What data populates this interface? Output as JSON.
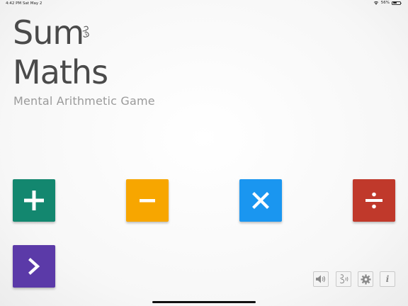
{
  "status_bar": {
    "time": "4:42 PM",
    "date": "Sat May 2",
    "battery": "56%",
    "battery_level": 0.56,
    "icons": [
      "wifi-icon",
      "battery-icon"
    ]
  },
  "app": {
    "title_line1": "Sum",
    "title_line2": "Maths",
    "subtitle": "Mental Arithmetic Game",
    "logo_icon": "doodle-logo-icon"
  },
  "operations": [
    {
      "name": "addition-button",
      "icon": "plus-icon",
      "color": "#13876f"
    },
    {
      "name": "subtraction-button",
      "icon": "minus-icon",
      "color": "#f7a600"
    },
    {
      "name": "multiplication-button",
      "icon": "times-icon",
      "color": "#1a96f0"
    },
    {
      "name": "division-button",
      "icon": "divide-icon",
      "color": "#c0392b"
    }
  ],
  "next_button": {
    "icon": "chevron-right-icon",
    "color": "#5b3aa8"
  },
  "utility_buttons": [
    {
      "name": "sound-button",
      "icon": "speaker-icon"
    },
    {
      "name": "voice-button",
      "icon": "voice-icon"
    },
    {
      "name": "settings-button",
      "icon": "gear-icon"
    },
    {
      "name": "info-button",
      "icon": "info-icon",
      "glyph": "i"
    }
  ]
}
